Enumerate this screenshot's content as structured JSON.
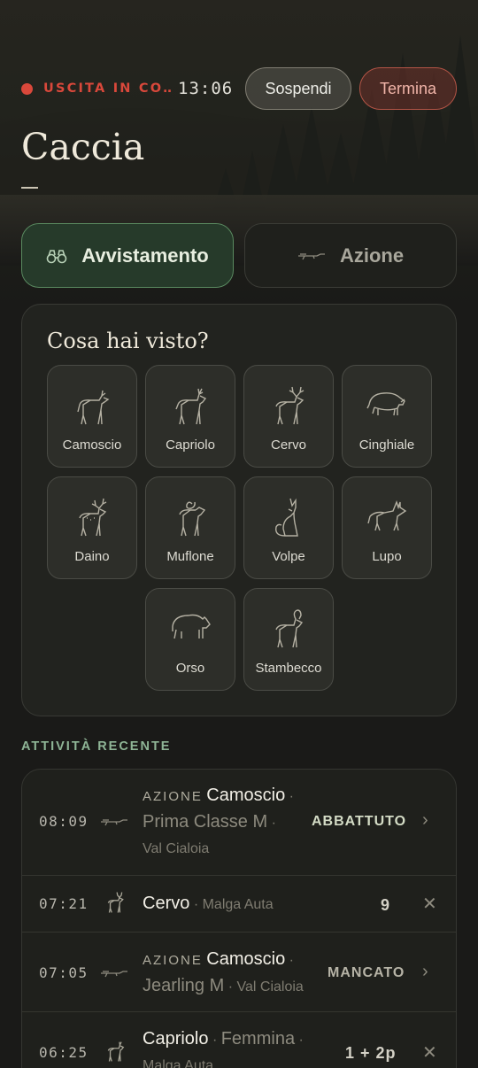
{
  "status": {
    "label": "USCITA IN CO…",
    "time": "13:06",
    "suspend_label": "Sospendi",
    "end_label": "Termina"
  },
  "title": "Caccia",
  "tabs": [
    {
      "label": "Avvistamento",
      "icon": "binoculars-icon",
      "active": true
    },
    {
      "label": "Azione",
      "icon": "rifle-icon",
      "active": false
    }
  ],
  "picker": {
    "title": "Cosa hai visto?",
    "animals": [
      {
        "label": "Camoscio",
        "icon": "chamois-icon"
      },
      {
        "label": "Capriolo",
        "icon": "roe-deer-icon"
      },
      {
        "label": "Cervo",
        "icon": "red-deer-icon"
      },
      {
        "label": "Cinghiale",
        "icon": "wild-boar-icon"
      },
      {
        "label": "Daino",
        "icon": "fallow-deer-icon"
      },
      {
        "label": "Muflone",
        "icon": "mouflon-icon"
      },
      {
        "label": "Volpe",
        "icon": "fox-icon"
      },
      {
        "label": "Lupo",
        "icon": "wolf-icon"
      },
      {
        "label": "Orso",
        "icon": "bear-icon"
      },
      {
        "label": "Stambecco",
        "icon": "ibex-icon"
      }
    ]
  },
  "recent": {
    "heading": "ATTIVITÀ RECENTE",
    "items": [
      {
        "time": "08:09",
        "icon": "rifle-icon",
        "tag": "AZIONE",
        "animal": "Camoscio",
        "sep1": "·",
        "detail": "Prima Classe M",
        "sep2": "·",
        "place": "Val Cialoia",
        "status": "ABBATTUTO",
        "action": "›"
      },
      {
        "time": "07:21",
        "icon": "deer-icon",
        "animal": "Cervo",
        "sep1": "·",
        "place": "Malga Auta",
        "status": "9",
        "action": "✕"
      },
      {
        "time": "07:05",
        "icon": "rifle-icon",
        "tag": "AZIONE",
        "animal": "Camoscio",
        "sep1": "·",
        "detail": "Jearling M",
        "sep2": "·",
        "place": "Val Cialoia",
        "status": "MANCATO",
        "action": "›"
      },
      {
        "time": "06:25",
        "icon": "deer-icon",
        "animal": "Capriolo",
        "sep1": "·",
        "detail": "Femmina",
        "sep2": "·",
        "place": "Malga Auta",
        "status": "1 + 2p",
        "action": "✕"
      }
    ]
  },
  "colors": {
    "accent_green": "#5a8a60",
    "alert_red": "#d9483b",
    "success_text": "#d4dcc6"
  }
}
